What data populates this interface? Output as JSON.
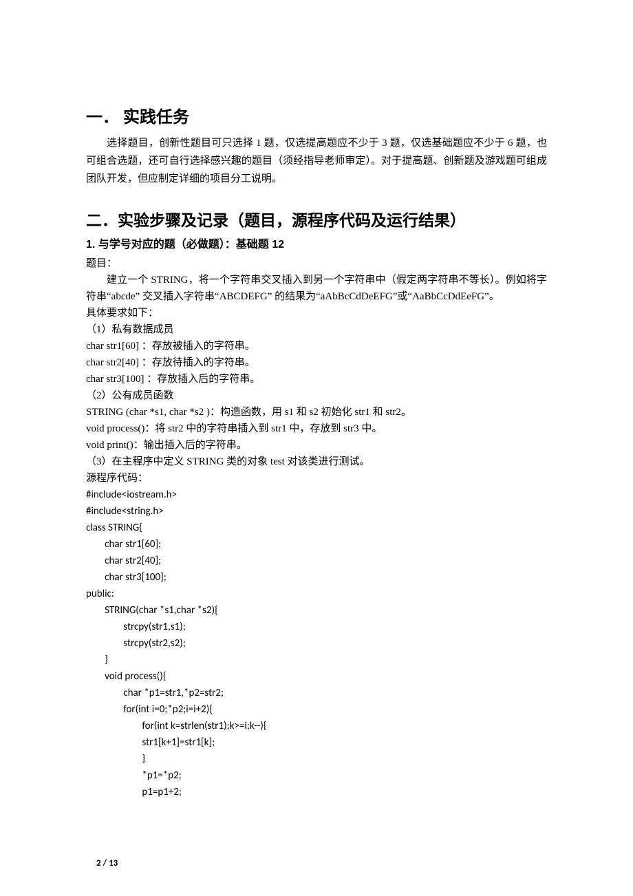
{
  "section1": {
    "heading": "一．    实践任务",
    "intro": "选择题目，创新性题目可只选择 1 题，仅选提高题应不少于 3 题，仅选基础题应不少于 6 题，也可组合选题，还可自行选择感兴趣的题目（须经指导老师审定）。对于提高题、创新题及游戏题可组成团队开发，但应制定详细的项目分工说明。"
  },
  "section2": {
    "heading": "二．实验步骤及记录（题目，源程序代码及运行结果）",
    "sub1": {
      "heading": "1.  与学号对应的题（必做题）：基础题  12",
      "label_topic": "题目：",
      "desc": "建立一个 STRING，将一个字符串交叉插入到另一个字符串中（假定两字符串不等长）。例如将字符串“abcde”  交叉插入字符串“ABCDEFG”  的结果为“aAbBcCdDeEFG”或“AaBbCcDdEeFG”。",
      "req_title": "具体要求如下：",
      "req_items": [
        "（1）私有数据成员",
        " char str1[60]  ：存放被插入的字符串。",
        " char str2[40]  ：存放待插入的字符串。",
        " char str3[100]  ：存放插入后的字符串。",
        "（2）公有成员函数",
        " STRING (char *s1, char *s2 )：构造函数，用 s1  和 s2  初始化 str1  和 str2。",
        " void process()：将 str2  中的字符串插入到 str1  中，存放到 str3  中。",
        " void print()：输出插入后的字符串。",
        "（3）在主程序中定义 STRING  类的对象 test  对该类进行测试。"
      ],
      "label_source": "源程序代码：",
      "code": "#include<iostream.h>\n#include<string.h>\nclass STRING{\n        char str1[60];\n        char str2[40];\n        char str3[100];\npublic:\n        STRING(char *s1,char *s2){\n                strcpy(str1,s1);\n                strcpy(str2,s2);\n        }\n        void process(){\n                char *p1=str1,*p2=str2;\n                for(int i=0;*p2;i=i+2){\n                        for(int k=strlen(str1);k>=i;k--){\n                        str1[k+1]=str1[k];\n                        }\n                        *p1=*p2;\n                        p1=p1+2;"
    }
  },
  "footer": {
    "page": "2",
    "sep": " / ",
    "total": "13"
  }
}
